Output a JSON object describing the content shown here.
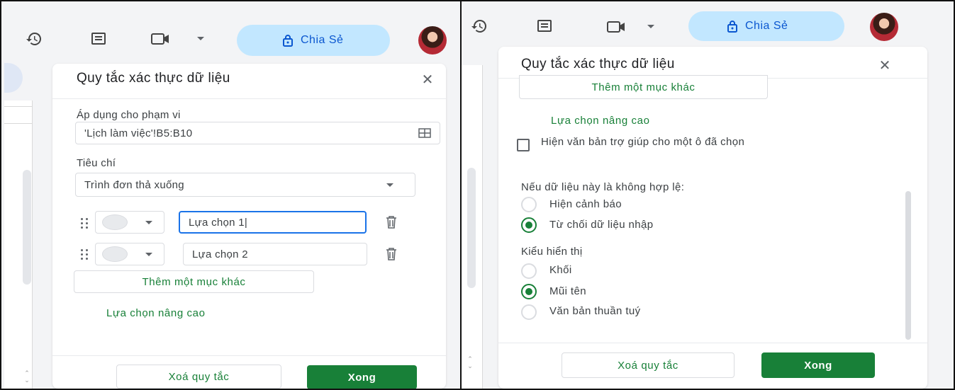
{
  "toolbar": {
    "share_label": "Chia Sẻ",
    "icons": [
      "history-icon",
      "comment-icon",
      "video-call-icon",
      "chevron-down-icon",
      "lock-icon"
    ]
  },
  "left_dialog": {
    "title": "Quy tắc xác thực dữ liệu",
    "range_label": "Áp dụng cho phạm vi",
    "range_value": "'Lịch làm việc'!B5:B10",
    "criteria_label": "Tiêu chí",
    "criteria_value": "Trình đơn thả xuống",
    "items": [
      {
        "value": "Lựa chọn 1|"
      },
      {
        "value": "Lựa chọn 2"
      }
    ],
    "add_item_label": "Thêm một mục khác",
    "advanced_label": "Lựa chọn nâng cao",
    "remove_label": "Xoá quy tắc",
    "done_label": "Xong"
  },
  "right_dialog": {
    "title": "Quy tắc xác thực dữ liệu",
    "add_item_label": "Thêm một mục khác",
    "advanced_label": "Lựa chọn nâng cao",
    "help_text_label": "Hiện văn bản trợ giúp cho một ô đã chọn",
    "help_text_checked": false,
    "invalid_heading": "Nếu dữ liệu này là không hợp lệ:",
    "invalid_options": [
      {
        "label": "Hiện cảnh báo",
        "selected": false
      },
      {
        "label": "Từ chối dữ liệu nhập",
        "selected": true
      }
    ],
    "display_heading": "Kiểu hiển thị",
    "display_options": [
      {
        "label": "Khối",
        "selected": false
      },
      {
        "label": "Mũi tên",
        "selected": true
      },
      {
        "label": "Văn bản thuần tuý",
        "selected": false
      }
    ],
    "remove_label": "Xoá quy tắc",
    "done_label": "Xong"
  },
  "colors": {
    "accent_green": "#188038",
    "share_bg": "#c2e7ff",
    "share_text": "#0b57d0",
    "focus_blue": "#1a73e8"
  }
}
